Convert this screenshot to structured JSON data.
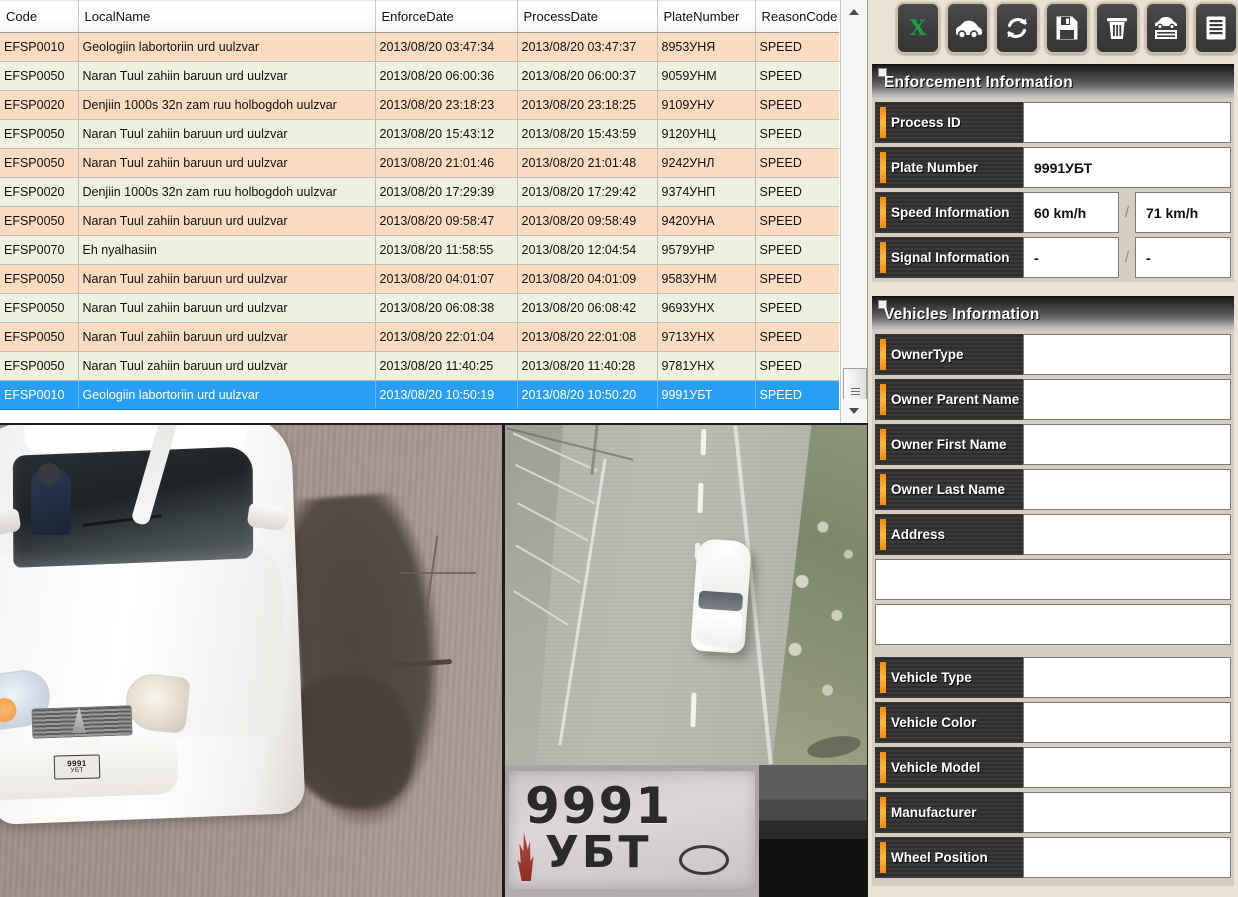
{
  "grid": {
    "columns": [
      "Code",
      "LocalName",
      "EnforceDate",
      "ProcessDate",
      "PlateNumber",
      "ReasonCode"
    ],
    "rows": [
      {
        "code": "EFSP0010",
        "local_name": "Geologiin labortoriin urd uulzvar",
        "enforce_date": "2013/08/20 03:47:34",
        "process_date": "2013/08/20 03:47:37",
        "plate": "8953УНЯ",
        "reason": "SPEED"
      },
      {
        "code": "EFSP0050",
        "local_name": "Naran Tuul zahiin baruun urd uulzvar",
        "enforce_date": "2013/08/20 06:00:36",
        "process_date": "2013/08/20 06:00:37",
        "plate": "9059УНМ",
        "reason": "SPEED"
      },
      {
        "code": "EFSP0020",
        "local_name": "Denjiin 1000s 32n zam ruu holbogdoh uulzvar",
        "enforce_date": "2013/08/20 23:18:23",
        "process_date": "2013/08/20 23:18:25",
        "plate": "9109УНУ",
        "reason": "SPEED"
      },
      {
        "code": "EFSP0050",
        "local_name": "Naran Tuul zahiin baruun urd uulzvar",
        "enforce_date": "2013/08/20 15:43:12",
        "process_date": "2013/08/20 15:43:59",
        "plate": "9120УНЦ",
        "reason": "SPEED"
      },
      {
        "code": "EFSP0050",
        "local_name": "Naran Tuul zahiin baruun urd uulzvar",
        "enforce_date": "2013/08/20 21:01:46",
        "process_date": "2013/08/20 21:01:48",
        "plate": "9242УНЛ",
        "reason": "SPEED"
      },
      {
        "code": "EFSP0020",
        "local_name": "Denjiin 1000s 32n zam ruu holbogdoh uulzvar",
        "enforce_date": "2013/08/20 17:29:39",
        "process_date": "2013/08/20 17:29:42",
        "plate": "9374УНП",
        "reason": "SPEED"
      },
      {
        "code": "EFSP0050",
        "local_name": "Naran Tuul zahiin baruun urd uulzvar",
        "enforce_date": "2013/08/20 09:58:47",
        "process_date": "2013/08/20 09:58:49",
        "plate": "9420УНА",
        "reason": "SPEED"
      },
      {
        "code": "EFSP0070",
        "local_name": "Eh nyalhasiin",
        "enforce_date": "2013/08/20 11:58:55",
        "process_date": "2013/08/20 12:04:54",
        "plate": "9579УНР",
        "reason": "SPEED"
      },
      {
        "code": "EFSP0050",
        "local_name": "Naran Tuul zahiin baruun urd uulzvar",
        "enforce_date": "2013/08/20 04:01:07",
        "process_date": "2013/08/20 04:01:09",
        "plate": "9583УНМ",
        "reason": "SPEED"
      },
      {
        "code": "EFSP0050",
        "local_name": "Naran Tuul zahiin baruun urd uulzvar",
        "enforce_date": "2013/08/20 06:08:38",
        "process_date": "2013/08/20 06:08:42",
        "plate": "9693УНХ",
        "reason": "SPEED"
      },
      {
        "code": "EFSP0050",
        "local_name": "Naran Tuul zahiin baruun urd uulzvar",
        "enforce_date": "2013/08/20 22:01:04",
        "process_date": "2013/08/20 22:01:08",
        "plate": "9713УНХ",
        "reason": "SPEED"
      },
      {
        "code": "EFSP0050",
        "local_name": "Naran Tuul zahiin baruun urd uulzvar",
        "enforce_date": "2013/08/20 11:40:25",
        "process_date": "2013/08/20 11:40:28",
        "plate": "9781УНХ",
        "reason": "SPEED"
      },
      {
        "code": "EFSP0010",
        "local_name": "Geologiin labortoriin urd uulzvar",
        "enforce_date": "2013/08/20 10:50:19",
        "process_date": "2013/08/20 10:50:20",
        "plate": "9991УБТ",
        "reason": "SPEED",
        "selected": true
      }
    ]
  },
  "toolbar": {
    "buttons": [
      {
        "name": "export-excel-button",
        "icon": "excel-icon",
        "label": "Export to Excel"
      },
      {
        "name": "vehicle-lookup-button",
        "icon": "car-icon",
        "label": "Vehicle"
      },
      {
        "name": "refresh-button",
        "icon": "refresh-icon",
        "label": "Refresh"
      },
      {
        "name": "save-button",
        "icon": "floppy-disk-icon",
        "label": "Save"
      },
      {
        "name": "delete-button",
        "icon": "trash-icon",
        "label": "Delete"
      },
      {
        "name": "vehicle-report-button",
        "icon": "car-list-icon",
        "label": "Vehicle Report"
      },
      {
        "name": "report-list-button",
        "icon": "document-list-icon",
        "label": "Report"
      }
    ]
  },
  "enforcement": {
    "title": "Enforcement Information",
    "fields": {
      "process_id_label": "Process ID",
      "process_id_value": "",
      "plate_number_label": "Plate Number",
      "plate_number_value": "9991УБТ",
      "speed_label": "Speed Information",
      "speed_limit_value": "60 km/h",
      "speed_measured_value": "71 km/h",
      "signal_label": "Signal Information",
      "signal_value_1": "-",
      "signal_value_2": "-",
      "separator": "/"
    }
  },
  "vehicles": {
    "title": "Vehicles Information",
    "fields": [
      {
        "label": "OwnerType",
        "value": ""
      },
      {
        "label": "Owner Parent Name",
        "value": ""
      },
      {
        "label": "Owner First Name",
        "value": ""
      },
      {
        "label": "Owner Last Name",
        "value": ""
      },
      {
        "label": "Address",
        "value": ""
      }
    ],
    "extra_values": [
      "",
      ""
    ],
    "fields2": [
      {
        "label": "Vehicle Type",
        "value": ""
      },
      {
        "label": "Vehicle Color",
        "value": ""
      },
      {
        "label": "Vehicle Model",
        "value": ""
      },
      {
        "label": "Manufacturer",
        "value": ""
      },
      {
        "label": "Wheel Position",
        "value": ""
      }
    ]
  },
  "images": {
    "closeup_caption": "vehicle-closeup-photo",
    "overview_caption": "road-overview-photo",
    "plate_crop": {
      "line1": "9991",
      "line2": "УБТ"
    }
  },
  "colors": {
    "row_odd": "#fbdcc0",
    "row_even": "#eff0dd",
    "row_selected": "#2a9df4",
    "accent_orange": "#ff8a00",
    "chrome_bg": "#ece2d3"
  }
}
